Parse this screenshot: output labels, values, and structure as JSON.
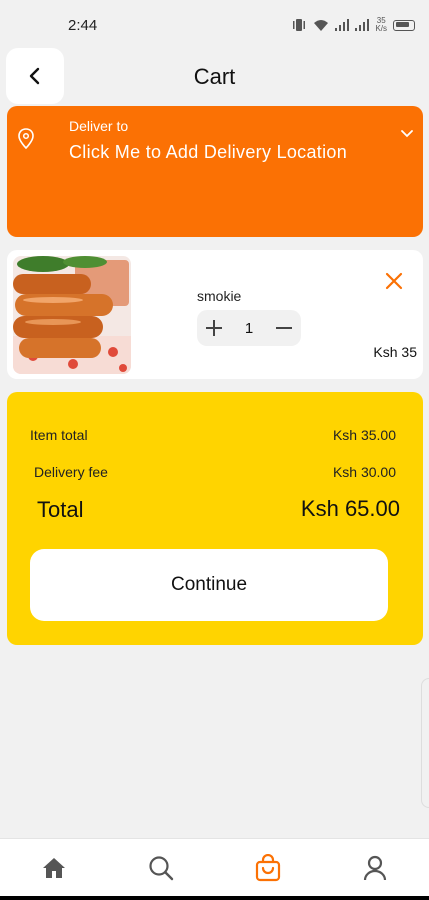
{
  "status_bar": {
    "time": "2:44",
    "net_speed_top": "35",
    "net_speed_bottom": "K/s",
    "battery": "68"
  },
  "header": {
    "title": "Cart"
  },
  "delivery": {
    "label": "Deliver to",
    "value": "Click Me to Add Delivery Location"
  },
  "cart_items": [
    {
      "name": "smokie",
      "quantity": "1",
      "price": "Ksh 35"
    }
  ],
  "summary": {
    "item_total_label": "Item total",
    "item_total_value": "Ksh 35.00",
    "delivery_fee_label": "Delivery fee",
    "delivery_fee_value": "Ksh 30.00",
    "total_label": "Total",
    "total_value": "Ksh 65.00",
    "continue_label": "Continue"
  },
  "colors": {
    "accent_orange": "#fb7104",
    "summary_yellow": "#ffd400",
    "background": "#f1f1f1"
  },
  "bottom_nav": [
    {
      "icon": "home-icon",
      "active": false
    },
    {
      "icon": "search-icon",
      "active": false
    },
    {
      "icon": "shopping-bag-icon",
      "active": true
    },
    {
      "icon": "profile-icon",
      "active": false
    }
  ]
}
